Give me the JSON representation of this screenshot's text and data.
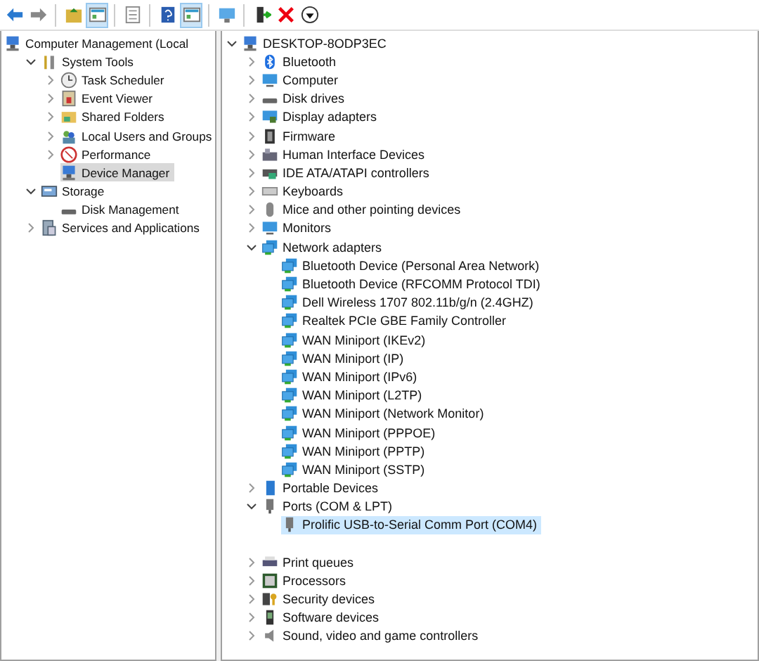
{
  "toolbar": [
    {
      "kind": "back",
      "pressed": false
    },
    {
      "kind": "forward",
      "pressed": false
    },
    {
      "kind": "sep"
    },
    {
      "kind": "up",
      "pressed": false
    },
    {
      "kind": "tree",
      "pressed": true
    },
    {
      "kind": "sep"
    },
    {
      "kind": "properties",
      "pressed": false
    },
    {
      "kind": "sep"
    },
    {
      "kind": "help",
      "pressed": false
    },
    {
      "kind": "pane",
      "pressed": true
    },
    {
      "kind": "sep"
    },
    {
      "kind": "scan",
      "pressed": false
    },
    {
      "kind": "sep"
    },
    {
      "kind": "enable",
      "pressed": false
    },
    {
      "kind": "uninstall",
      "pressed": false
    },
    {
      "kind": "update",
      "pressed": false
    }
  ],
  "console_tree": [
    {
      "label": "Computer Management (Local",
      "selected": false,
      "children": [
        {
          "label": "System Tools",
          "expanded": true,
          "selected": false,
          "children": [
            {
              "label": "Task Scheduler",
              "expanded": false,
              "selected": false
            },
            {
              "label": "Event Viewer",
              "expanded": false,
              "selected": false
            },
            {
              "label": "Shared Folders",
              "expanded": false,
              "selected": false
            },
            {
              "label": "Local Users and Groups",
              "expanded": false,
              "selected": false
            },
            {
              "label": "Performance",
              "expanded": false,
              "selected": false
            },
            {
              "label": "Device Manager",
              "selected": true
            }
          ]
        },
        {
          "label": "Storage",
          "expanded": true,
          "selected": false,
          "children": [
            {
              "label": "Disk Management",
              "selected": false
            }
          ]
        },
        {
          "label": "Services and Applications",
          "expanded": false,
          "selected": false
        }
      ]
    }
  ],
  "device_tree": [
    {
      "label": "DESKTOP-8ODP3EC",
      "expanded": true,
      "selected": false,
      "children": [
        {
          "label": "Bluetooth",
          "expanded": false,
          "selected": false
        },
        {
          "label": "Computer",
          "expanded": false,
          "selected": false
        },
        {
          "label": "Disk drives",
          "expanded": false,
          "selected": false
        },
        {
          "label": "Display adapters",
          "expanded": false,
          "selected": false
        },
        {
          "label": "Firmware",
          "expanded": false,
          "selected": false
        },
        {
          "label": "Human Interface Devices",
          "expanded": false,
          "selected": false
        },
        {
          "label": "IDE ATA/ATAPI controllers",
          "expanded": false,
          "selected": false
        },
        {
          "label": "Keyboards",
          "expanded": false,
          "selected": false
        },
        {
          "label": "Mice and other pointing devices",
          "expanded": false,
          "selected": false
        },
        {
          "label": "Monitors",
          "expanded": false,
          "selected": false
        },
        {
          "label": "Network adapters",
          "expanded": true,
          "selected": false,
          "children": [
            {
              "label": "Bluetooth Device (Personal Area Network)",
              "selected": false
            },
            {
              "label": "Bluetooth Device (RFCOMM Protocol TDI)",
              "selected": false
            },
            {
              "label": "Dell Wireless 1707 802.11b/g/n (2.4GHZ)",
              "selected": false
            },
            {
              "label": "Realtek PCIe GBE Family Controller",
              "selected": false
            },
            {
              "label": "WAN Miniport (IKEv2)",
              "selected": false
            },
            {
              "label": "WAN Miniport (IP)",
              "selected": false
            },
            {
              "label": "WAN Miniport (IPv6)",
              "selected": false
            },
            {
              "label": "WAN Miniport (L2TP)",
              "selected": false
            },
            {
              "label": "WAN Miniport (Network Monitor)",
              "selected": false
            },
            {
              "label": "WAN Miniport (PPPOE)",
              "selected": false
            },
            {
              "label": "WAN Miniport (PPTP)",
              "selected": false
            },
            {
              "label": "WAN Miniport (SSTP)",
              "selected": false
            }
          ]
        },
        {
          "label": "Portable Devices",
          "expanded": false,
          "selected": false
        },
        {
          "label": "Ports (COM & LPT)",
          "expanded": true,
          "selected": false,
          "children": [
            {
              "label": "Prolific USB-to-Serial Comm Port (COM4)",
              "selected": true
            }
          ]
        },
        {
          "label": "Print queues",
          "expanded": false,
          "selected": false,
          "spaced": true
        },
        {
          "label": "Processors",
          "expanded": false,
          "selected": false
        },
        {
          "label": "Security devices",
          "expanded": false,
          "selected": false
        },
        {
          "label": "Software devices",
          "expanded": false,
          "selected": false
        },
        {
          "label": "Sound, video and game controllers",
          "expanded": false,
          "selected": false
        }
      ]
    }
  ]
}
